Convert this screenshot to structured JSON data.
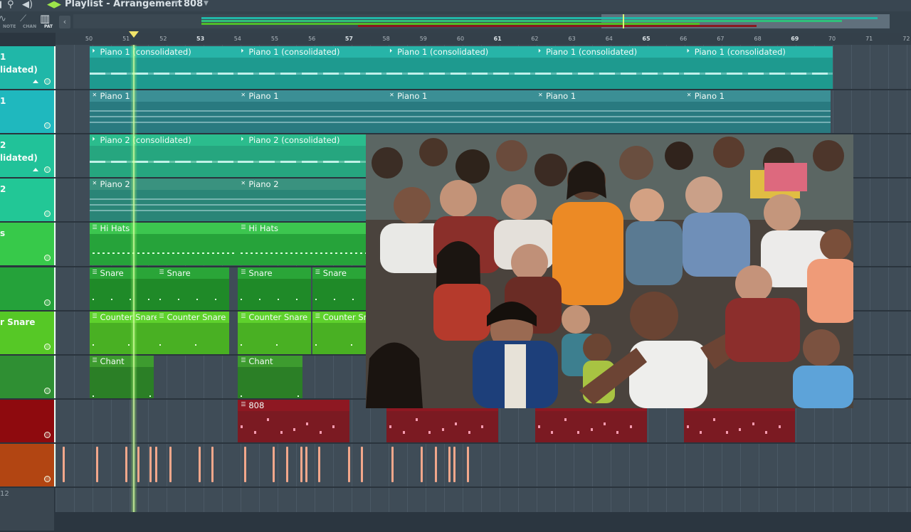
{
  "window": {
    "title": "Playlist - Arrangement",
    "pattern": "808"
  },
  "toolbar": {
    "mode_labels": [
      "NOTE",
      "CHAN",
      "PAT"
    ],
    "active_mode": "PAT"
  },
  "ruler": {
    "bars": [
      "50",
      "51",
      "52",
      "53",
      "54",
      "55",
      "56",
      "57",
      "58",
      "59",
      "60",
      "61",
      "62",
      "63",
      "64",
      "65",
      "66",
      "67",
      "68",
      "69",
      "70",
      "71",
      "72"
    ]
  },
  "playhead": {
    "bar": 51.2
  },
  "tracks": [
    {
      "label": "1\nlidated)",
      "color": "#20b7a8"
    },
    {
      "label": "1",
      "color": "#1fb8be"
    },
    {
      "label": "2\nlidated)",
      "color": "#21c299"
    },
    {
      "label": "2",
      "color": "#22c796"
    },
    {
      "label": "s",
      "color": "#37c94a"
    },
    {
      "label": "",
      "color": "#25a23a"
    },
    {
      "label": "r Snare",
      "color": "#56c826"
    },
    {
      "label": "",
      "color": "#2f8f33"
    },
    {
      "label": "",
      "color": "#8e0a0e"
    },
    {
      "label": "",
      "color": "#b24512"
    },
    {
      "label": "12",
      "color": "#3a4650"
    }
  ],
  "clips": {
    "piano1_consolidated": "Piano 1 (consolidated)",
    "piano1": "Piano 1",
    "piano2_consolidated": "Piano 2 (consolidated)",
    "piano2": "Piano 2",
    "piano2_consolidated_cut": "Pia",
    "piano2_cut": "Pia",
    "hi_hats": "Hi Hats",
    "hi_hats_cut": "Hi",
    "snare": "Snare",
    "snare_cut": "Sn",
    "counter_snare": "Counter Snare",
    "counter_snare_cut": "Co",
    "chant": "Chant",
    "chant_cut": "Cha",
    "b808": "808",
    "b808_cut": "80"
  },
  "colors": {
    "piano1_consolidated": "#1e9a8f",
    "piano1_pattern": "#297a80",
    "piano2_consolidated": "#26a67f",
    "piano2_pattern": "#2a8577",
    "hi_hats": "#26a33a",
    "snare": "#1f8a28",
    "counter_snare": "#49b023",
    "chant": "#2b7f26",
    "b808": "#7b1a22",
    "perc_notes": "#f2a78b",
    "playhead": "#b8ff7a",
    "marker": "#f0e36a"
  }
}
